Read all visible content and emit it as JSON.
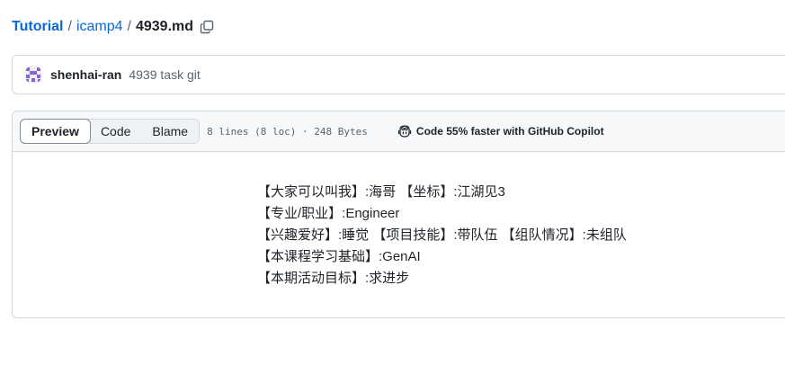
{
  "breadcrumb": {
    "root": "Tutorial",
    "folder": "icamp4",
    "file": "4939.md",
    "separator": "/"
  },
  "commit": {
    "author": "shenhai-ran",
    "message": "4939 task git"
  },
  "file_header": {
    "tabs": [
      {
        "label": "Preview",
        "active": true
      },
      {
        "label": "Code",
        "active": false
      },
      {
        "label": "Blame",
        "active": false
      }
    ],
    "meta": "8 lines (8 loc) · 248 Bytes",
    "copilot_label": "Code 55% faster with GitHub Copilot"
  },
  "content": {
    "lines": [
      "【大家可以叫我】:海哥 【坐标】:江湖见3",
      "【专业/职业】:Engineer",
      "【兴趣爱好】:睡觉 【项目技能】:带队伍 【组队情况】:未组队",
      "【本课程学习基础】:GenAI",
      "【本期活动目标】:求进步"
    ]
  },
  "icons": {
    "copy": "copy-icon",
    "avatar": "identicon-avatar",
    "copilot": "copilot-icon"
  },
  "colors": {
    "link": "#0969da",
    "muted": "#59636e",
    "border": "#d1d9e0",
    "header_bg": "#f6f8fa",
    "avatar": "#8a63d2"
  }
}
